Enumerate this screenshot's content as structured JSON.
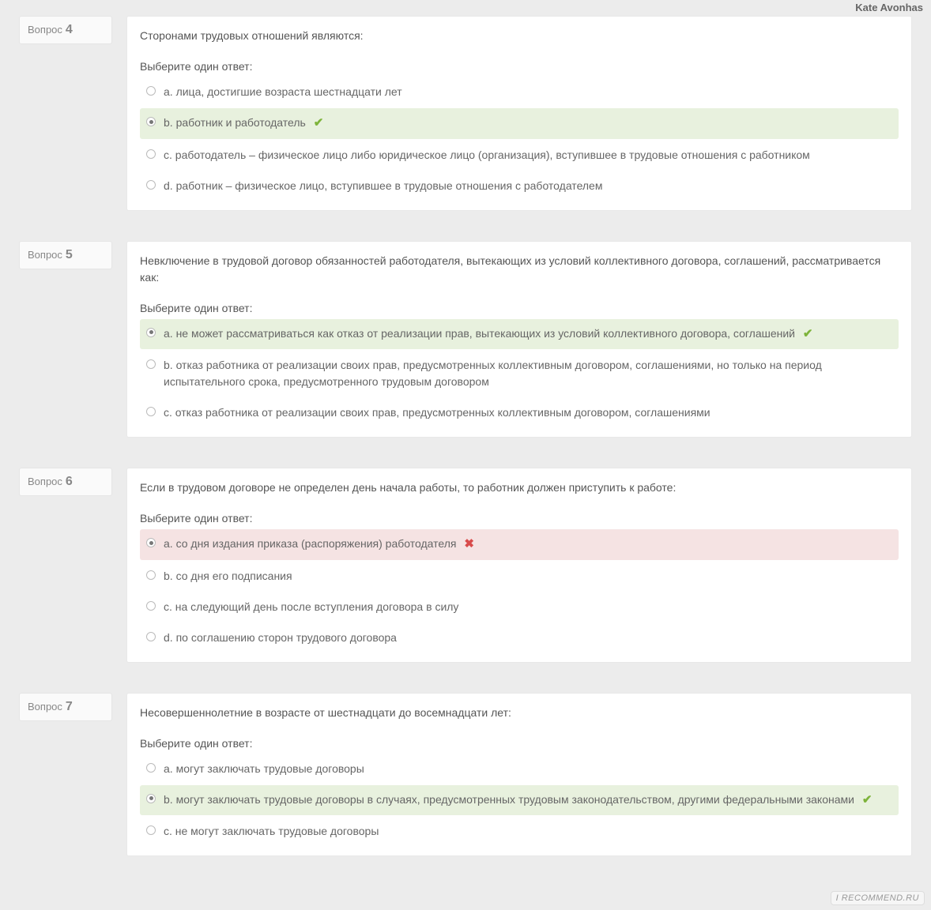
{
  "watermark_top": "Kate Avonhas",
  "watermark_bottom": "I RECOMMEND.RU",
  "question_label": "Вопрос",
  "instruction": "Выберите один ответ:",
  "questions": [
    {
      "number": "4",
      "text": "Сторонами трудовых отношений являются:",
      "answers": [
        {
          "label": "a. лица, достигшие возраста шестнадцати лет",
          "selected": false,
          "state": ""
        },
        {
          "label": "b. работник и работодатель",
          "selected": true,
          "state": "correct"
        },
        {
          "label": "c. работодатель – физическое лицо либо юридическое лицо (организация), вступившее в трудовые отношения с работником",
          "selected": false,
          "state": ""
        },
        {
          "label": "d. работник – физическое лицо, вступившее в трудовые отношения с работодателем",
          "selected": false,
          "state": ""
        }
      ]
    },
    {
      "number": "5",
      "text": "Невключение в трудовой договор обязанностей работодателя, вытекающих из условий коллективного договора, соглашений, рассматривается как:",
      "answers": [
        {
          "label": "a. не может рассматриваться как отказ от реализации прав, вытекающих из условий коллективного договора, соглашений",
          "selected": true,
          "state": "correct"
        },
        {
          "label": "b. отказ работника от реализации своих прав, предусмотренных коллективным договором, соглашениями, но только на период испытательного срока, предусмотренного трудовым договором",
          "selected": false,
          "state": ""
        },
        {
          "label": "c. отказ работника от реализации своих прав, предусмотренных коллективным договором, соглашениями",
          "selected": false,
          "state": ""
        }
      ]
    },
    {
      "number": "6",
      "text": "Если в трудовом договоре не определен день начала работы, то работник должен приступить к работе:",
      "answers": [
        {
          "label": "a. со дня издания приказа (распоряжения) работодателя",
          "selected": true,
          "state": "incorrect"
        },
        {
          "label": "b. со дня его подписания",
          "selected": false,
          "state": ""
        },
        {
          "label": "c. на следующий день после вступления договора в силу",
          "selected": false,
          "state": ""
        },
        {
          "label": "d. по соглашению сторон трудового договора",
          "selected": false,
          "state": ""
        }
      ]
    },
    {
      "number": "7",
      "text": "Несовершеннолетние в возрасте от шестнадцати до восемнадцати лет:",
      "answers": [
        {
          "label": "a. могут заключать трудовые договоры",
          "selected": false,
          "state": ""
        },
        {
          "label": "b. могут заключать трудовые договоры в случаях, предусмотренных трудовым законодательством, другими федеральными законами",
          "selected": true,
          "state": "correct"
        },
        {
          "label": "c. не могут заключать трудовые договоры",
          "selected": false,
          "state": ""
        }
      ]
    }
  ]
}
